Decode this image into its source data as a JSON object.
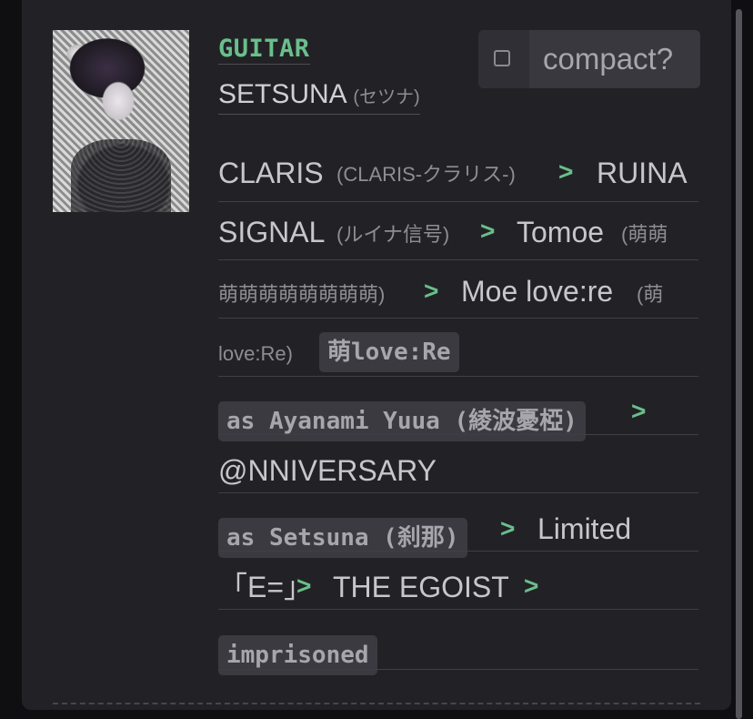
{
  "member": {
    "role": "GUITAR",
    "name": "SETSUNA",
    "name_alt": "(セツナ)"
  },
  "compact_toggle": {
    "label": "compact?",
    "checked": false
  },
  "history": {
    "separator": ">",
    "l1_claris": "CLARIS",
    "l1_claris_alt": "(CLARIS-クラリス-)",
    "l1_ruina": "RUINA",
    "l2_signal": "SIGNAL",
    "l2_signal_alt": "(ルイナ信号)",
    "l2_tomoe": "Tomoe",
    "l2_tomoe_alt": "(萌萌",
    "l3_tomoe_alt_cont": "萌萌萌萌萌萌萌萌)",
    "l3_moe": "Moe love:re",
    "l3_moe_alt": "(萌",
    "l4_moe_alt_cont": "love:Re)",
    "tag_moe": "萌love:Re",
    "tag_ayanami": "as Ayanami Yuua (綾波憂椏)",
    "anniversary": "@NNIVERSARY",
    "tag_setsuna": "as Setsuna (刹那)",
    "limited": "Limited",
    "limited_cont": "「E=」",
    "egoist": "THE EGOIST",
    "tag_imprisoned": "imprisoned"
  }
}
